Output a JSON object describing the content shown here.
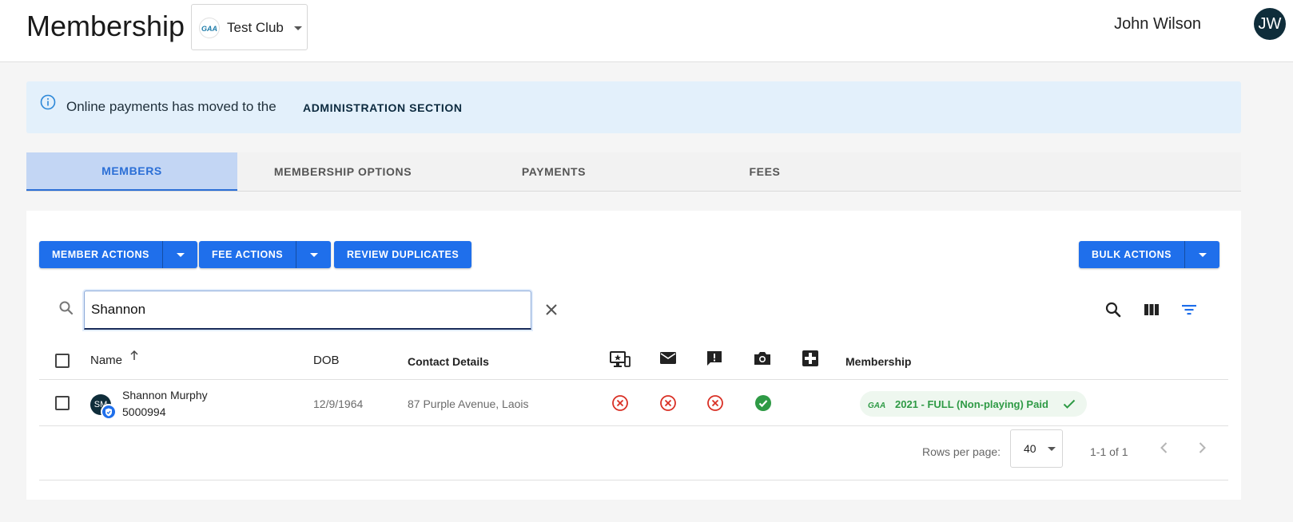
{
  "header": {
    "title": "Membership",
    "club": "Test Club",
    "user_name": "John Wilson",
    "user_initials": "JW"
  },
  "banner": {
    "text": "Online payments has moved to the",
    "link": "ADMINISTRATION SECTION"
  },
  "tabs": [
    {
      "label": "MEMBERS",
      "active": true
    },
    {
      "label": "MEMBERSHIP OPTIONS",
      "active": false
    },
    {
      "label": "PAYMENTS",
      "active": false
    },
    {
      "label": "FEES",
      "active": false
    }
  ],
  "actions": {
    "member_actions": "MEMBER ACTIONS",
    "fee_actions": "FEE ACTIONS",
    "review_duplicates": "REVIEW DUPLICATES",
    "bulk_actions": "BULK ACTIONS"
  },
  "search": {
    "value": "Shannon"
  },
  "table": {
    "columns": {
      "name": "Name",
      "dob": "DOB",
      "contact": "Contact Details",
      "membership": "Membership"
    },
    "icon_columns": [
      "online-member-icon",
      "email-icon",
      "alert-icon",
      "camera-icon",
      "medical-icon"
    ],
    "rows": [
      {
        "initials": "SM",
        "name": "Shannon Murphy",
        "member_id": "5000994",
        "dob": "12/9/1964",
        "contact": "87 Purple Avenue, Laois",
        "statuses": [
          "cross",
          "cross",
          "cross",
          "check"
        ],
        "membership": "2021 - FULL (Non-playing) Paid"
      }
    ]
  },
  "pagination": {
    "rows_per_page_label": "Rows per page:",
    "rows_per_page": "40",
    "range": "1-1 of 1"
  },
  "colors": {
    "primary": "#1f6feb",
    "tab_active_bg": "#c3d6f4",
    "banner_bg": "#e3f0fb",
    "success": "#2e9a45",
    "error": "#d93025",
    "avatar": "#0f2d3a"
  }
}
